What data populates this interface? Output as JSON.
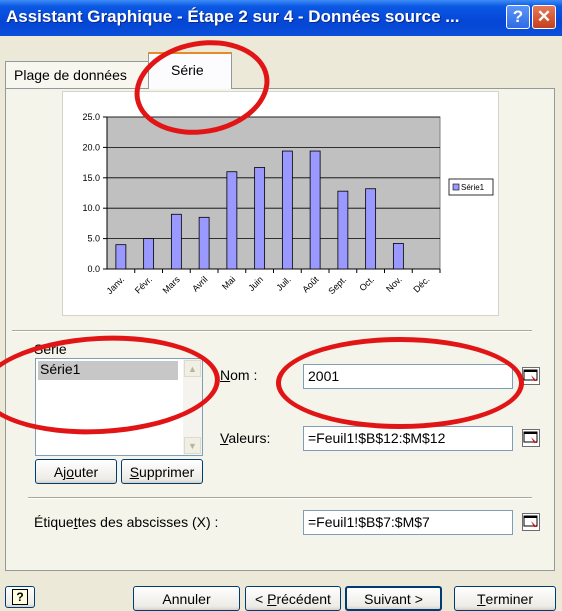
{
  "window": {
    "title": "Assistant Graphique - Étape 2 sur 4 - Données source ...",
    "help_glyph": "?",
    "close_glyph": "✕"
  },
  "tabs": [
    {
      "label": "Plage de données"
    },
    {
      "label": "Série"
    }
  ],
  "chart_data": {
    "type": "bar",
    "categories": [
      "Janv.",
      "Févr.",
      "Mars",
      "Avril",
      "Mai",
      "Juin",
      "Juil.",
      "Août",
      "Sept.",
      "Oct.",
      "Nov.",
      "Déc."
    ],
    "series": [
      {
        "name": "Série1",
        "values": [
          4.0,
          5.0,
          9.0,
          8.5,
          16.0,
          16.7,
          19.4,
          19.4,
          12.8,
          13.2,
          4.2,
          0
        ],
        "color": "#9999ff"
      }
    ],
    "yticks": [
      "25.0",
      "20.0",
      "15.0",
      "10.0",
      "5.0",
      "0.0"
    ],
    "ylim": [
      0,
      25
    ],
    "grid": true,
    "legend": "right",
    "plot_bg": "#c0c0c0"
  },
  "series_panel": {
    "title": "Série",
    "items": [
      "Série1"
    ],
    "name_label_prefix": "N",
    "name_label_rest": "om :",
    "name_value": "2001",
    "values_label_prefix": "V",
    "values_label_rest": "aleurs:",
    "values_value": "=Feuil1!$B$12:$M$12",
    "add_prefix": "Aj",
    "add_u": "o",
    "add_rest": "uter",
    "delete_u": "S",
    "delete_rest": "upprimer",
    "xlabels_prefix": "Étique",
    "xlabels_u": "t",
    "xlabels_rest": "tes des abscisses (X) :",
    "xlabels_value": "=Feuil1!$B$7:$M$7"
  },
  "footer": {
    "help_glyph": "?",
    "cancel": "Annuler",
    "prev_prefix": "< ",
    "prev_u": "P",
    "prev_rest": "récédent",
    "next_prefix": "Suivant ",
    "next_suffix": ">",
    "finish_u": "T",
    "finish_rest": "erminer"
  },
  "colors": {
    "title_bar": "#0546d6",
    "annotation": "#e11515",
    "bar_fill": "#9999ff"
  }
}
